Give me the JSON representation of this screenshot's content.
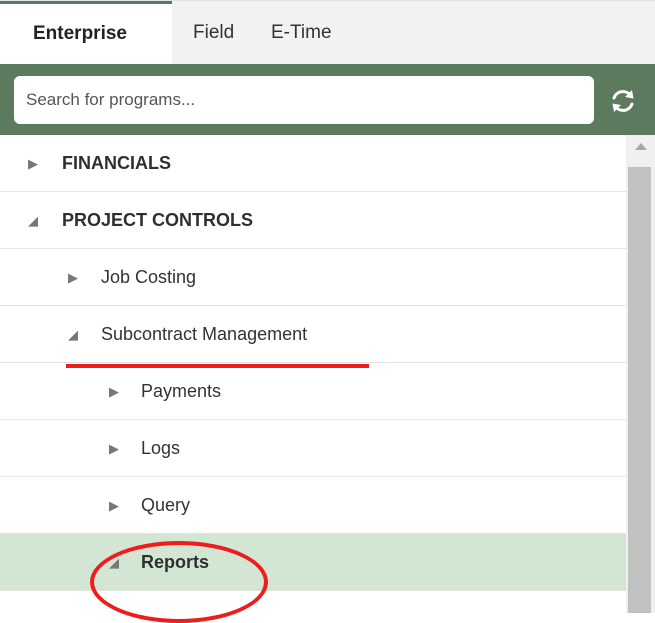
{
  "tabs": [
    {
      "label": "Enterprise",
      "active": true
    },
    {
      "label": "Field",
      "active": false
    },
    {
      "label": "E-Time",
      "active": false
    }
  ],
  "search": {
    "placeholder": "Search for programs..."
  },
  "refresh_icon": "refresh-icon",
  "tree": [
    {
      "label": "FINANCIALS",
      "expanded": false,
      "bold": true
    },
    {
      "label": "PROJECT CONTROLS",
      "expanded": true,
      "bold": true
    },
    {
      "label": "Job Costing",
      "expanded": false,
      "bold": false
    },
    {
      "label": "Subcontract Management",
      "expanded": true,
      "bold": false
    },
    {
      "label": "Payments",
      "expanded": false,
      "bold": false
    },
    {
      "label": "Logs",
      "expanded": false,
      "bold": false
    },
    {
      "label": "Query",
      "expanded": false,
      "bold": false
    },
    {
      "label": "Reports",
      "expanded": true,
      "bold": true,
      "selected": true
    }
  ],
  "colors": {
    "accent": "#5b7a5e",
    "selected_row": "#d3e5d3",
    "annotation": "#ee1c1c"
  }
}
